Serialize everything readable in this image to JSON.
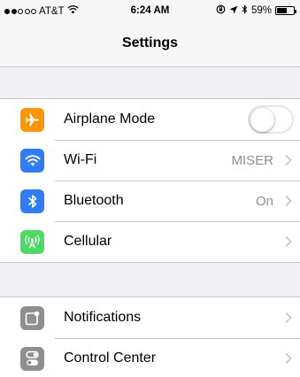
{
  "status_bar": {
    "carrier": "AT&T",
    "time": "6:24 AM",
    "battery": "59%",
    "battery_level": 0.59
  },
  "nav": {
    "title": "Settings"
  },
  "colors": {
    "airplane": "#ff9500",
    "wifi": "#2f7cf6",
    "bluetooth": "#2f7cf6",
    "cellular": "#4cd964",
    "notifications": "#8e8e93",
    "control_center": "#8e8e93"
  },
  "groups": [
    {
      "rows": [
        {
          "label": "Airplane Mode",
          "icon": "airplane-icon",
          "control": "toggle",
          "toggle_on": false
        },
        {
          "label": "Wi-Fi",
          "icon": "wifi-icon",
          "value": "MISER",
          "control": "chevron"
        },
        {
          "label": "Bluetooth",
          "icon": "bluetooth-icon",
          "value": "On",
          "control": "chevron"
        },
        {
          "label": "Cellular",
          "icon": "cellular-icon",
          "control": "chevron"
        }
      ]
    },
    {
      "rows": [
        {
          "label": "Notifications",
          "icon": "notifications-icon",
          "control": "chevron"
        },
        {
          "label": "Control Center",
          "icon": "control-center-icon",
          "control": "chevron"
        }
      ]
    }
  ]
}
